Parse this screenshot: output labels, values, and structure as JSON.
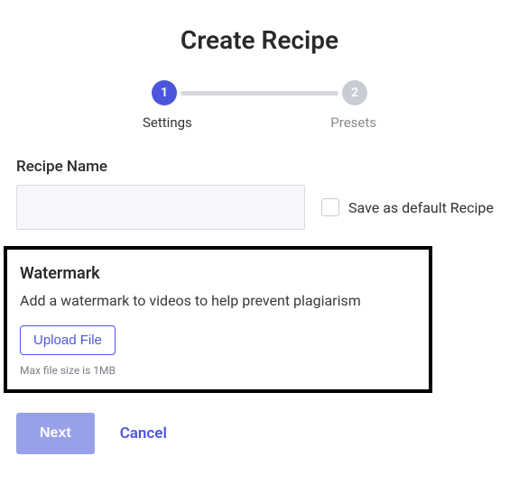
{
  "title": "Create Recipe",
  "stepper": {
    "steps": [
      {
        "num": "1",
        "label": "Settings",
        "active": true
      },
      {
        "num": "2",
        "label": "Presets",
        "active": false
      }
    ]
  },
  "recipe_name": {
    "label": "Recipe Name",
    "value": ""
  },
  "save_default": {
    "label": "Save as default Recipe",
    "checked": false
  },
  "watermark": {
    "title": "Watermark",
    "description": "Add a watermark to videos to help prevent plagiarism",
    "upload_label": "Upload File",
    "hint": "Max file size is 1MB"
  },
  "actions": {
    "next": "Next",
    "cancel": "Cancel"
  }
}
